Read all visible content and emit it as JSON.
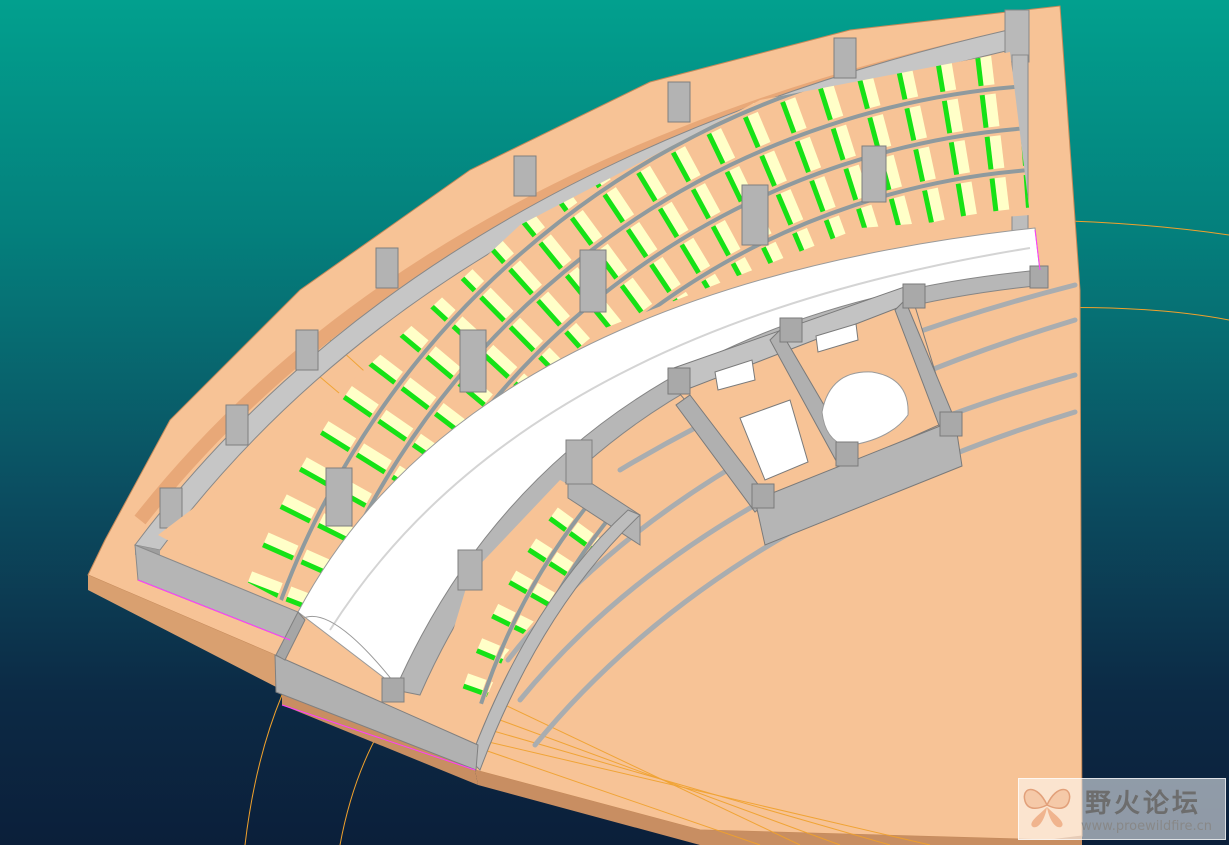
{
  "viewport": {
    "model": "curved auditorium seating (3D CAD shaded view)",
    "background_top": "#02a08e",
    "background_bottom": "#0b1f3a"
  },
  "colors": {
    "floor": "#f7c396",
    "wall": "#b9b9b9",
    "wall_top": "#c6c6c6",
    "seat_back": "#16e216",
    "seat_cushion": "#ffffc8",
    "aisle": "#ffffff",
    "datum_curve": "#f0a12c",
    "edge_highlight": "#ff3cff"
  },
  "watermark": {
    "title": "野火论坛",
    "url": "www.proewildfire.cn",
    "logo_icon": "butterfly-logo-icon"
  }
}
